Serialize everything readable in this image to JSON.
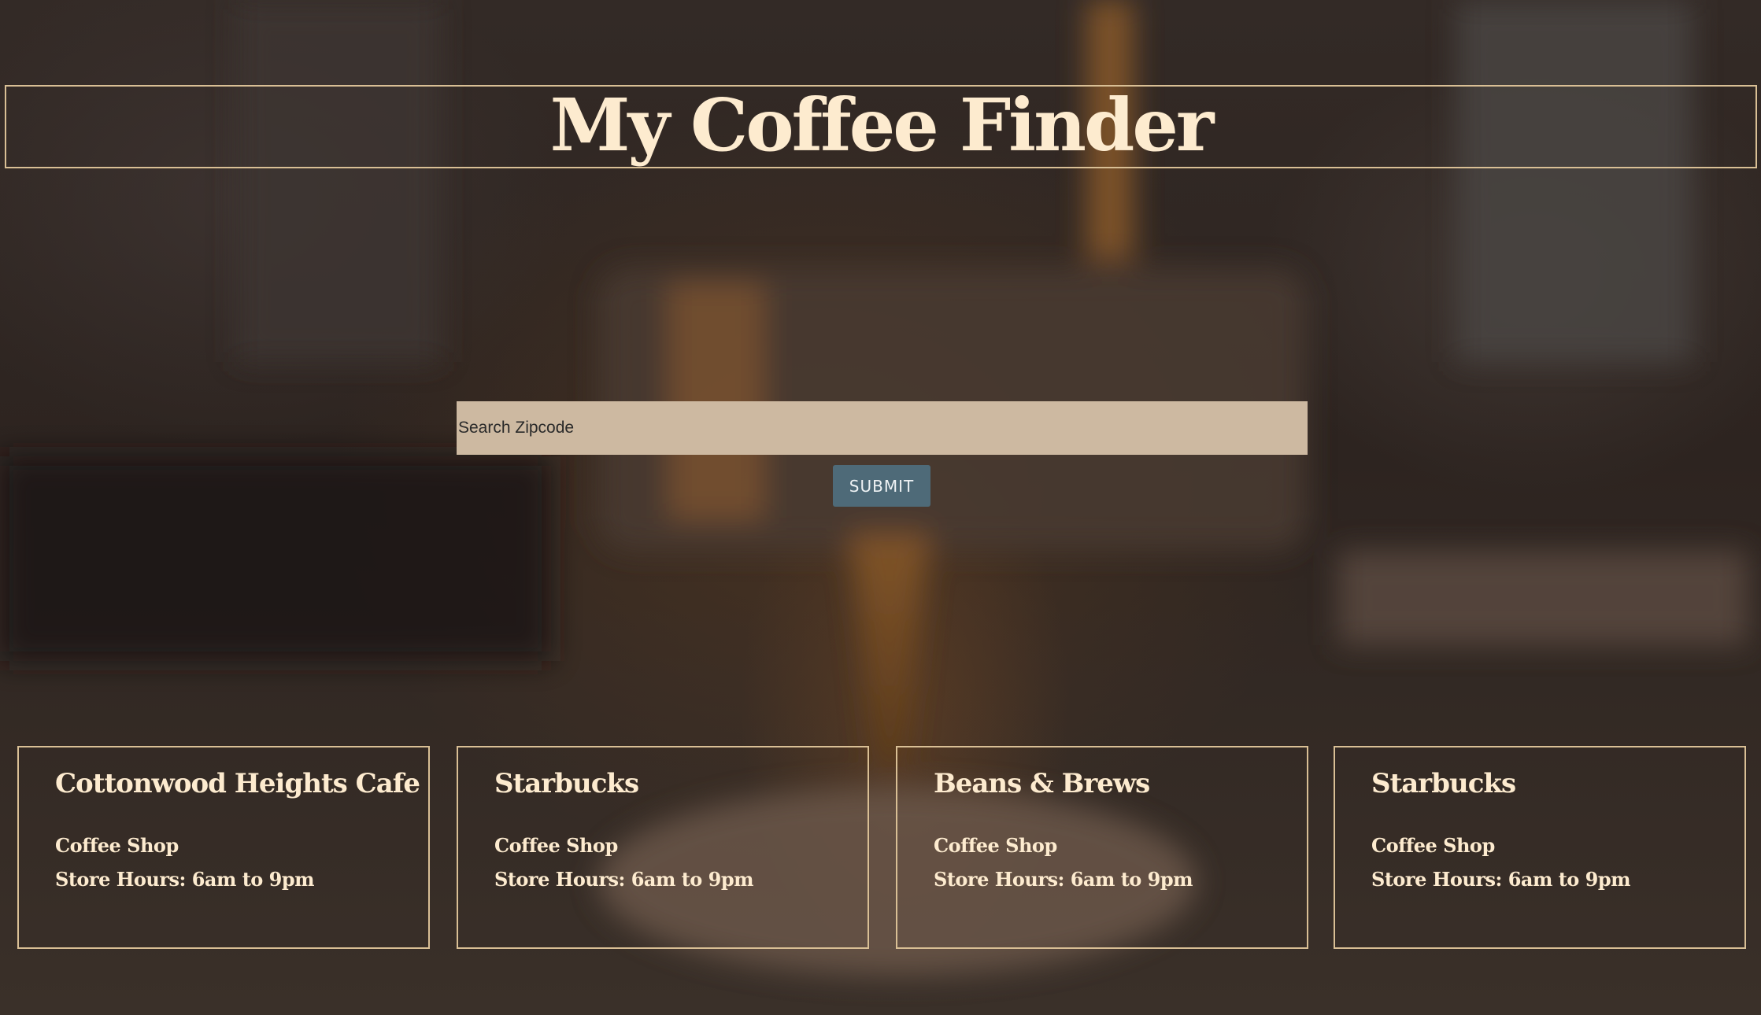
{
  "header": {
    "title": "My Coffee Finder"
  },
  "search": {
    "placeholder": "Search Zipcode",
    "value": "",
    "submit_label": "SUBMIT"
  },
  "shops": [
    {
      "name": "Cottonwood Heights Cafe",
      "type": "Coffee Shop",
      "hours": "Store Hours: 6am to 9pm"
    },
    {
      "name": "Starbucks",
      "type": "Coffee Shop",
      "hours": "Store Hours: 6am to 9pm"
    },
    {
      "name": "Beans & Brews",
      "type": "Coffee Shop",
      "hours": "Store Hours: 6am to 9pm"
    },
    {
      "name": "Starbucks",
      "type": "Coffee Shop",
      "hours": "Store Hours: 6am to 9pm"
    }
  ],
  "colors": {
    "accent_border": "#d9bf95",
    "title_text": "#fdebcf",
    "input_bg": "#cdb9a1",
    "button_bg": "#4e6a78"
  }
}
